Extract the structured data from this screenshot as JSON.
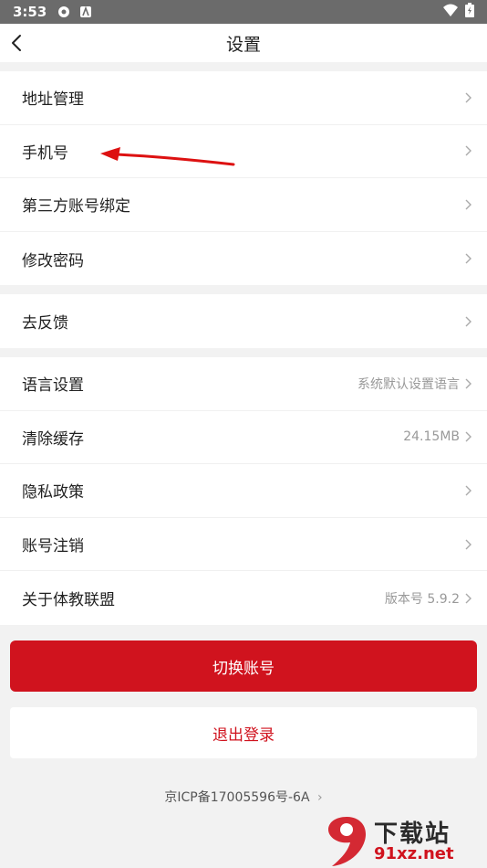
{
  "status_bar": {
    "time": "3:53"
  },
  "header": {
    "title": "设置"
  },
  "groups": [
    {
      "items": [
        {
          "label": "地址管理",
          "value": ""
        },
        {
          "label": "手机号",
          "value": ""
        },
        {
          "label": "第三方账号绑定",
          "value": ""
        },
        {
          "label": "修改密码",
          "value": ""
        }
      ]
    },
    {
      "items": [
        {
          "label": "去反馈",
          "value": ""
        }
      ]
    },
    {
      "items": [
        {
          "label": "语言设置",
          "value": "系统默认设置语言"
        },
        {
          "label": "清除缓存",
          "value": "24.15MB"
        },
        {
          "label": "隐私政策",
          "value": ""
        },
        {
          "label": "账号注销",
          "value": ""
        },
        {
          "label": "关于体教联盟",
          "value": "版本号 5.9.2"
        }
      ]
    }
  ],
  "buttons": {
    "switch_account": "切换账号",
    "logout": "退出登录"
  },
  "footer": {
    "icp": "京ICP备17005596号-6A"
  },
  "watermark": {
    "logo_text": "下载站",
    "site": "91xz.net"
  },
  "colors": {
    "accent": "#d0131e",
    "background": "#f2f2f2"
  }
}
